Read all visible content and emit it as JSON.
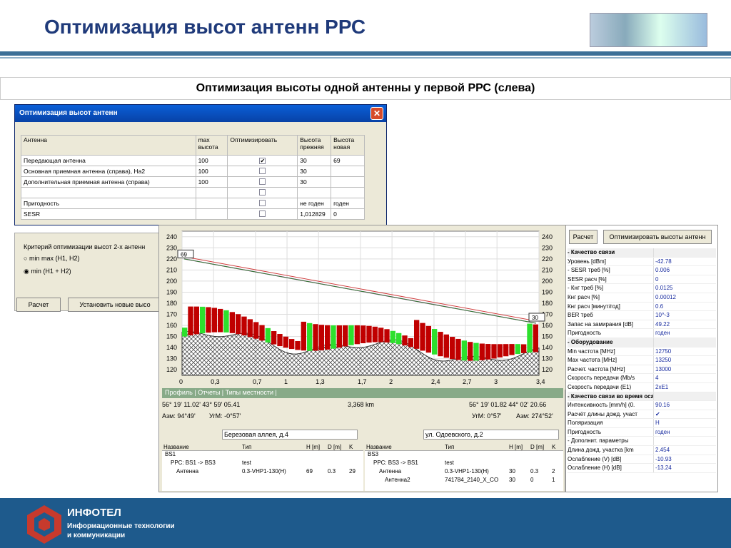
{
  "header": {
    "title": "Оптимизация высот антенн РРС"
  },
  "subtitle": "Оптимизация высоты одной антенны у первой РРС (слева)",
  "dialog": {
    "title": "Оптимизация высот антенн",
    "columns": [
      "Антенна",
      "max высота",
      "Оптимизировать",
      "Высота прежняя",
      "Высота новая"
    ],
    "rows": [
      {
        "name": "Передающая антенна",
        "max": "100",
        "opt": true,
        "old": "30",
        "new": "69"
      },
      {
        "name": "Основная приемная антенна (справа), На2",
        "max": "100",
        "opt": false,
        "old": "30",
        "new": ""
      },
      {
        "name": "Дополнительная приемная антенна (справа)",
        "max": "100",
        "opt": false,
        "old": "30",
        "new": ""
      },
      {
        "name": "",
        "max": "",
        "opt": false,
        "old": "",
        "new": ""
      },
      {
        "name": "Пригодность",
        "max": "",
        "opt": false,
        "old": "не годен",
        "new": "годен"
      },
      {
        "name": "SESR",
        "max": "",
        "opt": false,
        "old": "1,012829",
        "new": "0"
      }
    ],
    "criteria_label": "Критерий оптимизации высот 2-х антенн",
    "radio1": "min max (H1, H2)",
    "radio2": "min (H1 + H2)",
    "calc_btn": "Расчет",
    "set_btn": "Установить новые высо"
  },
  "profile": {
    "y_ticks": [
      "240",
      "230",
      "220",
      "210",
      "200",
      "190",
      "180",
      "170",
      "160",
      "150",
      "140",
      "130",
      "120"
    ],
    "x_ticks": [
      "0",
      "0,3",
      "0,7",
      "1",
      "1,3",
      "1,7",
      "2",
      "2,4",
      "2,7",
      "3",
      "3,4"
    ],
    "left_height": "69",
    "right_height": "30",
    "tabs": "Профиль | Отчеты | Типы местности |",
    "coord_left": "56° 19' 11.02' 43° 59' 05.41",
    "distance": "3,368 km",
    "coord_right": "56° 19' 01.82 44° 02' 20.66",
    "az_left": "Азм: 94°49'",
    "ugm_left": "УгМ: -0°57'",
    "ugm_right": "УгМ: 0°57'",
    "az_right": "Азм: 274°52'",
    "addr_left": "Березовая аллея, д.4",
    "addr_right": "ул. Одоевского, д.2",
    "tree_cols": [
      "Название",
      "Тип",
      "H [m]",
      "D [m]",
      "K"
    ],
    "left_tree": [
      {
        "name": "BS1",
        "type": "",
        "h": "",
        "d": "",
        "k": ""
      },
      {
        "name": "РРС: BS1 -> BS3",
        "type": "test",
        "h": "",
        "d": "",
        "k": ""
      },
      {
        "name": "Антенна",
        "type": "0.3-VHP1-130(H)",
        "h": "69",
        "d": "0.3",
        "k": "29"
      }
    ],
    "right_tree": [
      {
        "name": "BS3",
        "type": "",
        "h": "",
        "d": "",
        "k": ""
      },
      {
        "name": "РРС: BS3 -> BS1",
        "type": "test",
        "h": "",
        "d": "",
        "k": ""
      },
      {
        "name": "Антенна",
        "type": "0.3-VHP1-130(H)",
        "h": "30",
        "d": "0.3",
        "k": "2"
      },
      {
        "name": "Антенна2",
        "type": "741784_2140_X_CO",
        "h": "30",
        "d": "0",
        "k": "1"
      }
    ]
  },
  "panel": {
    "btn1": "Расчет",
    "btn2": "Оптимизировать высоты антенн",
    "rows": [
      {
        "k": "- Качество связи",
        "v": "",
        "cat": true
      },
      {
        "k": "Уровень [dBm]",
        "v": "-42.78"
      },
      {
        "k": "- SESR треб [%]",
        "v": "0.006"
      },
      {
        "k": "SESR расч [%]",
        "v": "0"
      },
      {
        "k": "- Кнг треб [%]",
        "v": "0.0125"
      },
      {
        "k": "Кнг расч [%]",
        "v": "0.00012"
      },
      {
        "k": "Кнг расч [минут/год]",
        "v": "0.6"
      },
      {
        "k": "BER треб",
        "v": "10^-3"
      },
      {
        "k": "Запас на замирания [dB]",
        "v": "49.22"
      },
      {
        "k": "Пригодность",
        "v": "годен"
      },
      {
        "k": "- Оборудование",
        "v": "",
        "cat": true
      },
      {
        "k": "Min частота [MHz]",
        "v": "12750"
      },
      {
        "k": "Max частота [MHz]",
        "v": "13250"
      },
      {
        "k": "Расчет. частота [MHz]",
        "v": "13000"
      },
      {
        "k": "Скорость передачи (Mb/s",
        "v": "4"
      },
      {
        "k": "Скорость передачи (E1)",
        "v": "2xE1"
      },
      {
        "k": "- Качество связи во время осадков",
        "v": "",
        "cat": true
      },
      {
        "k": "Интенсивность [mm/h] (0.",
        "v": "90.16"
      },
      {
        "k": "Расчёт длины дожд. участ",
        "v": "✔"
      },
      {
        "k": "Поляризация",
        "v": "H"
      },
      {
        "k": "Пригодность",
        "v": "годен"
      },
      {
        "k": "- Дополнит. параметры",
        "v": ""
      },
      {
        "k": "Длина дожд. участка [km",
        "v": "2.454"
      },
      {
        "k": "Ослабление (V) [dB]",
        "v": "-10.93"
      },
      {
        "k": "Ослабление (H) [dB]",
        "v": "-13.24"
      }
    ]
  },
  "footer": {
    "brand": "ИНФОТЕЛ",
    "tag1": "Информационные технологии",
    "tag2": "и коммуникации"
  }
}
